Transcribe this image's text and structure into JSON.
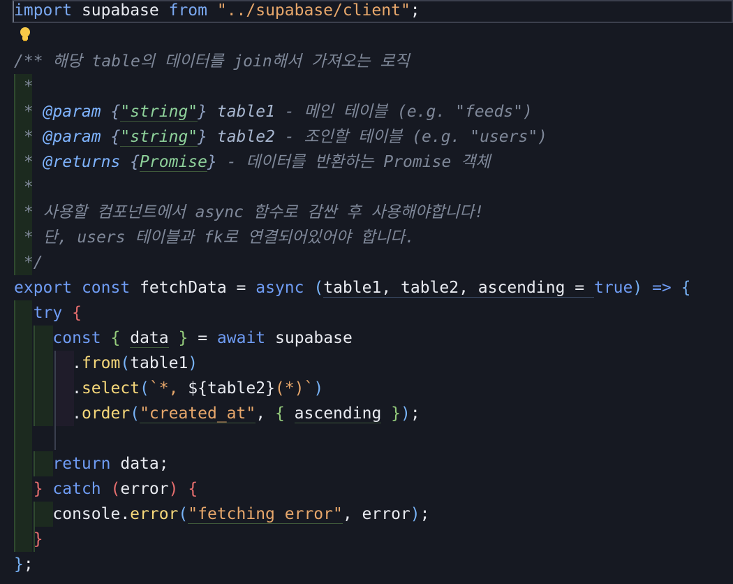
{
  "editor": {
    "lines": [
      "import supabase from \"../supabase/client\";",
      "/** 해당 table의 데이터를 join해서 가져오는 로직",
      " *",
      " * @param {\"string\"} table1 - 메인 테이블 (e.g. \"feeds\")",
      " * @param {\"string\"} table2 - 조인할 테이블 (e.g. \"users\")",
      " * @returns {Promise} - 데이터를 반환하는 Promise 객체",
      " *",
      " * 사용할 컴포넌트에서 async 함수로 감싼 후 사용해야합니다!",
      " * 단, users 테이블과 fk로 연결되어있어야 합니다.",
      " */",
      "export const fetchData = async (table1, table2, ascending = true) => {",
      "  try {",
      "    const { data } = await supabase",
      "      .from(table1)",
      "      .select(`*, ${table2}(*)`)",
      "      .order(\"created_at\", { ascending });",
      "",
      "    return data;",
      "  } catch (error) {",
      "    console.error(\"fetching error\", error);",
      "  }",
      "};"
    ]
  },
  "icons": {
    "lightbulb": "lightbulb-icon"
  },
  "colors": {
    "background": "#161922",
    "keyword": "#7aa8f0",
    "string": "#e7a76b",
    "comment": "#7f8899",
    "function": "#f5d77a"
  }
}
